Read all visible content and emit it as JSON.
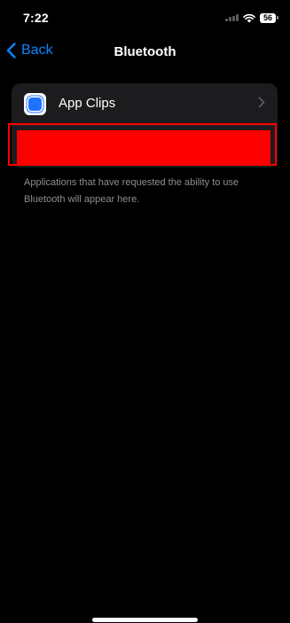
{
  "status_bar": {
    "time": "7:22",
    "battery_level": "56",
    "icons": [
      "signal-icon",
      "wifi-icon",
      "battery-icon"
    ]
  },
  "nav": {
    "back_label": "Back",
    "title": "Bluetooth"
  },
  "list": {
    "items": [
      {
        "label": "App Clips",
        "icon": "app-clips-icon"
      }
    ]
  },
  "footer_note": "Applications that have requested the ability to use Bluetooth will appear here.",
  "colors": {
    "accent": "#0a84ff",
    "background": "#000000",
    "cell_background": "#1c1c1e",
    "secondary_text": "#8e8e93",
    "redaction": "#ff0000"
  }
}
